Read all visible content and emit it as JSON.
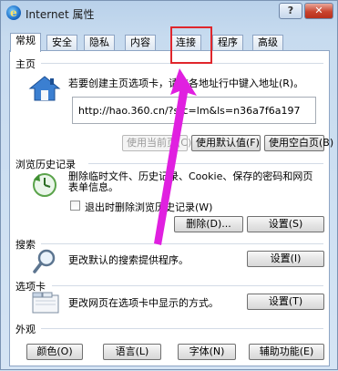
{
  "window": {
    "title": "Internet 属性",
    "help_label": "?",
    "close_label": "✕"
  },
  "tabs": [
    {
      "label": "常规",
      "active": true
    },
    {
      "label": "安全"
    },
    {
      "label": "隐私"
    },
    {
      "label": "内容"
    },
    {
      "label": "连接"
    },
    {
      "label": "程序"
    },
    {
      "label": "高级"
    }
  ],
  "home": {
    "title": "主页",
    "description": "若要创建主页选项卡，请在各地址行中键入地址(R)。",
    "url": "http://hao.360.cn/?src=lm&ls=n36a7f6a197",
    "use_current": "使用当前页(C)",
    "use_default": "使用默认值(F)",
    "use_blank": "使用空白页(B)"
  },
  "history": {
    "title": "浏览历史记录",
    "description_line1": "删除临时文件、历史记录、Cookie、保存的密码和网页",
    "description_line2": "表单信息。",
    "checkbox_label": "退出时删除浏览历史记录(W)",
    "delete_button": "删除(D)...",
    "settings_button": "设置(S)"
  },
  "search": {
    "title": "搜索",
    "description": "更改默认的搜索提供程序。",
    "settings_button": "设置(I)"
  },
  "tabs_section": {
    "title": "选项卡",
    "description": "更改网页在选项卡中显示的方式。",
    "settings_button": "设置(T)"
  },
  "appearance": {
    "title": "外观",
    "colors_button": "颜色(O)",
    "languages_button": "语言(L)",
    "fonts_button": "字体(N)",
    "accessibility_button": "辅助功能(E)"
  },
  "colors": {
    "annotation": "#e0262c",
    "arrow": "#e020e0"
  }
}
